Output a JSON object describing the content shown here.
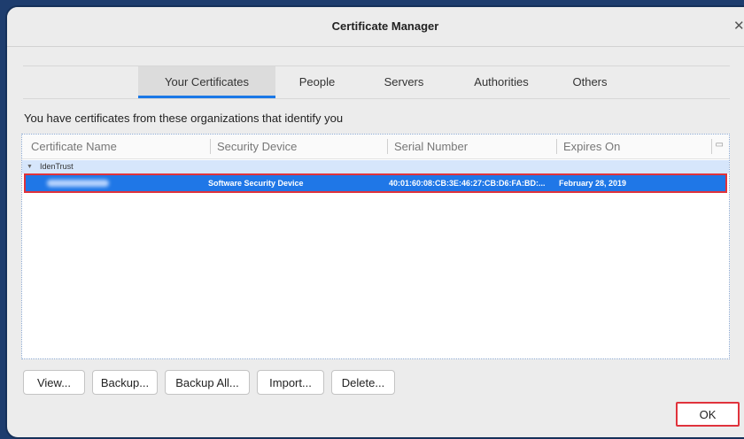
{
  "window": {
    "title": "Certificate Manager",
    "close_icon": "close-icon"
  },
  "tabs": [
    {
      "label": "Your Certificates",
      "active": true
    },
    {
      "label": "People",
      "active": false
    },
    {
      "label": "Servers",
      "active": false
    },
    {
      "label": "Authorities",
      "active": false
    },
    {
      "label": "Others",
      "active": false
    }
  ],
  "intro_text": "You have certificates from these organizations that identify you",
  "table": {
    "columns": [
      "Certificate Name",
      "Security Device",
      "Serial Number",
      "Expires On"
    ],
    "groups": [
      {
        "name": "IdenTrust",
        "rows": [
          {
            "certificate_name": "",
            "security_device": "Software Security Device",
            "serial_number": "40:01:60:08:CB:3E:46:27:CB:D6:FA:BD:...",
            "expires_on": "February 28, 2019",
            "selected": true
          }
        ]
      }
    ]
  },
  "buttons": {
    "view": "View...",
    "backup": "Backup...",
    "backup_all": "Backup All...",
    "import": "Import...",
    "delete": "Delete...",
    "ok": "OK"
  },
  "colors": {
    "selection": "#1f77e7",
    "group_highlight": "#d6e6fb",
    "tab_active_underline": "#1a78e6",
    "annotation_red": "#e0333c"
  }
}
